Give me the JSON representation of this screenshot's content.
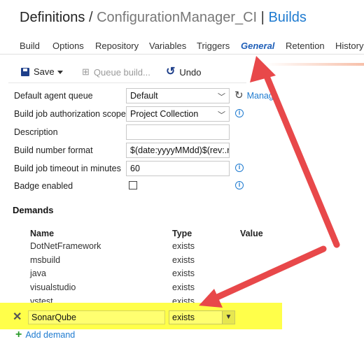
{
  "header": {
    "definitions": "Definitions",
    "separator": "/",
    "definition_name": "ConfigurationManager_CI",
    "pipe": "|",
    "builds": "Builds"
  },
  "tabs": [
    {
      "label": "Build"
    },
    {
      "label": "Options"
    },
    {
      "label": "Repository"
    },
    {
      "label": "Variables"
    },
    {
      "label": "Triggers"
    },
    {
      "label": "General",
      "active": true
    },
    {
      "label": "Retention"
    },
    {
      "label": "History"
    }
  ],
  "toolbar": {
    "save": "Save",
    "queue_build": "Queue build...",
    "undo": "Undo"
  },
  "form": {
    "agent_queue": {
      "label": "Default agent queue",
      "value": "Default",
      "manage": "Manage"
    },
    "auth_scope": {
      "label": "Build job authorization scope",
      "value": "Project Collection"
    },
    "description": {
      "label": "Description",
      "value": ""
    },
    "build_number": {
      "label": "Build number format",
      "value": "$(date:yyyyMMdd)$(rev:.r)"
    },
    "timeout": {
      "label": "Build job timeout in minutes",
      "value": "60"
    },
    "badge": {
      "label": "Badge enabled",
      "checked": false
    }
  },
  "demands": {
    "title": "Demands",
    "columns": {
      "name": "Name",
      "type": "Type",
      "value": "Value"
    },
    "rows": [
      {
        "name": "DotNetFramework",
        "type": "exists"
      },
      {
        "name": "msbuild",
        "type": "exists"
      },
      {
        "name": "java",
        "type": "exists"
      },
      {
        "name": "visualstudio",
        "type": "exists"
      },
      {
        "name": "vstest",
        "type": "exists"
      }
    ],
    "new_row": {
      "name": "SonarQube",
      "type": "exists"
    },
    "add_label": "Add demand"
  },
  "colors": {
    "accent": "#1f7bd0",
    "highlight": "#ffff4a",
    "arrow": "#e8484a"
  },
  "icons": [
    "save-icon",
    "queue-build-icon",
    "undo-icon",
    "refresh-icon",
    "info-icon",
    "remove-icon",
    "add-icon",
    "chevron-down-icon"
  ]
}
